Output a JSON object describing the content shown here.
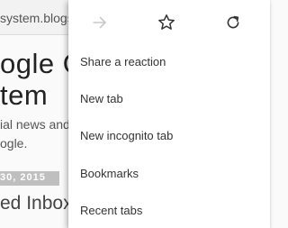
{
  "background_page": {
    "url_fragment": "system.blogs",
    "title_line1": "ogle O",
    "title_line2": "tem",
    "body_line1": "ial news and",
    "body_line2": "ogle.",
    "date": "30, 2015",
    "heading": "ed Inbox"
  },
  "menu": {
    "icons": {
      "forward": "forward-arrow-icon",
      "bookmark": "star-icon",
      "reload": "reload-icon"
    },
    "items": [
      {
        "label": "Share a reaction"
      },
      {
        "label": "New tab"
      },
      {
        "label": "New incognito tab"
      },
      {
        "label": "Bookmarks"
      },
      {
        "label": "Recent tabs"
      }
    ]
  },
  "colors": {
    "menu_bg": "#ffffff",
    "icon_active": "#333333",
    "icon_disabled": "#c8c8c8",
    "date_bar": "#bfbfbf"
  }
}
